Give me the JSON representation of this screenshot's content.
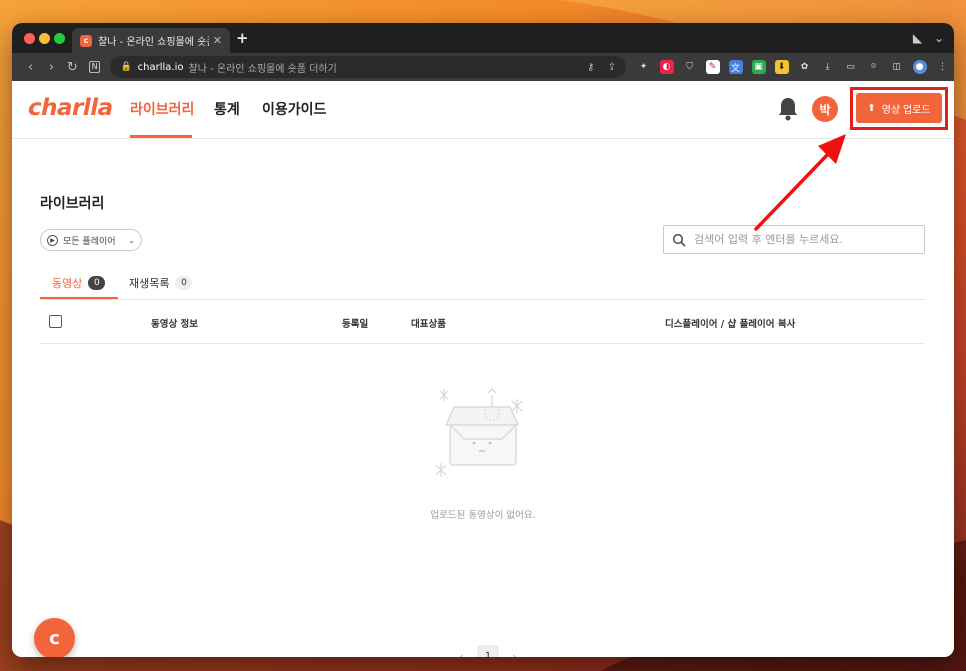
{
  "browser": {
    "tab_title": "챨나 - 온라인 쇼핑몰에 숏폼 더하기",
    "tab_favicon_letter": "c",
    "new_tab_symbol": "+",
    "url_domain": "charlla.io",
    "url_page_title": "챨나 - 온라인 쇼핑몰에 숏폼 더하기",
    "extensions": [
      "key-icon",
      "share-icon",
      "bookmark-icon",
      "extension-red-icon",
      "shield-icon",
      "pen-icon",
      "translate-icon",
      "green-icon",
      "download-ext-icon",
      "puzzle-icon",
      "download-icon",
      "video-icon",
      "screenshot-icon",
      "sidebar-icon",
      "profile-icon",
      "menu-icon"
    ]
  },
  "app": {
    "logo": "charlla",
    "nav": [
      {
        "label": "라이브러리",
        "active": true
      },
      {
        "label": "통계",
        "active": false
      },
      {
        "label": "이용가이드",
        "active": false
      }
    ],
    "avatar_initial": "박",
    "upload_button": "영상 업로드",
    "page_title": "라이브러리",
    "filter_label": "모든 플레이어",
    "search_placeholder": "검색어 입력 후 엔터를 누르세요.",
    "subtabs": [
      {
        "label": "동영상",
        "count": "0",
        "active": true
      },
      {
        "label": "재생목록",
        "count": "0",
        "active": false
      }
    ],
    "table_headers": [
      "동영상 정보",
      "등록일",
      "대표상품",
      "디스플레이어 / 샵 플레이어 복사"
    ],
    "empty_message": "업로드된 동영상이 없어요.",
    "pagination": {
      "prev": "‹",
      "current": "1",
      "next": "›"
    },
    "fab_letter": "c"
  },
  "colors": {
    "accent": "#f2643a",
    "highlight": "#e21e1e"
  }
}
